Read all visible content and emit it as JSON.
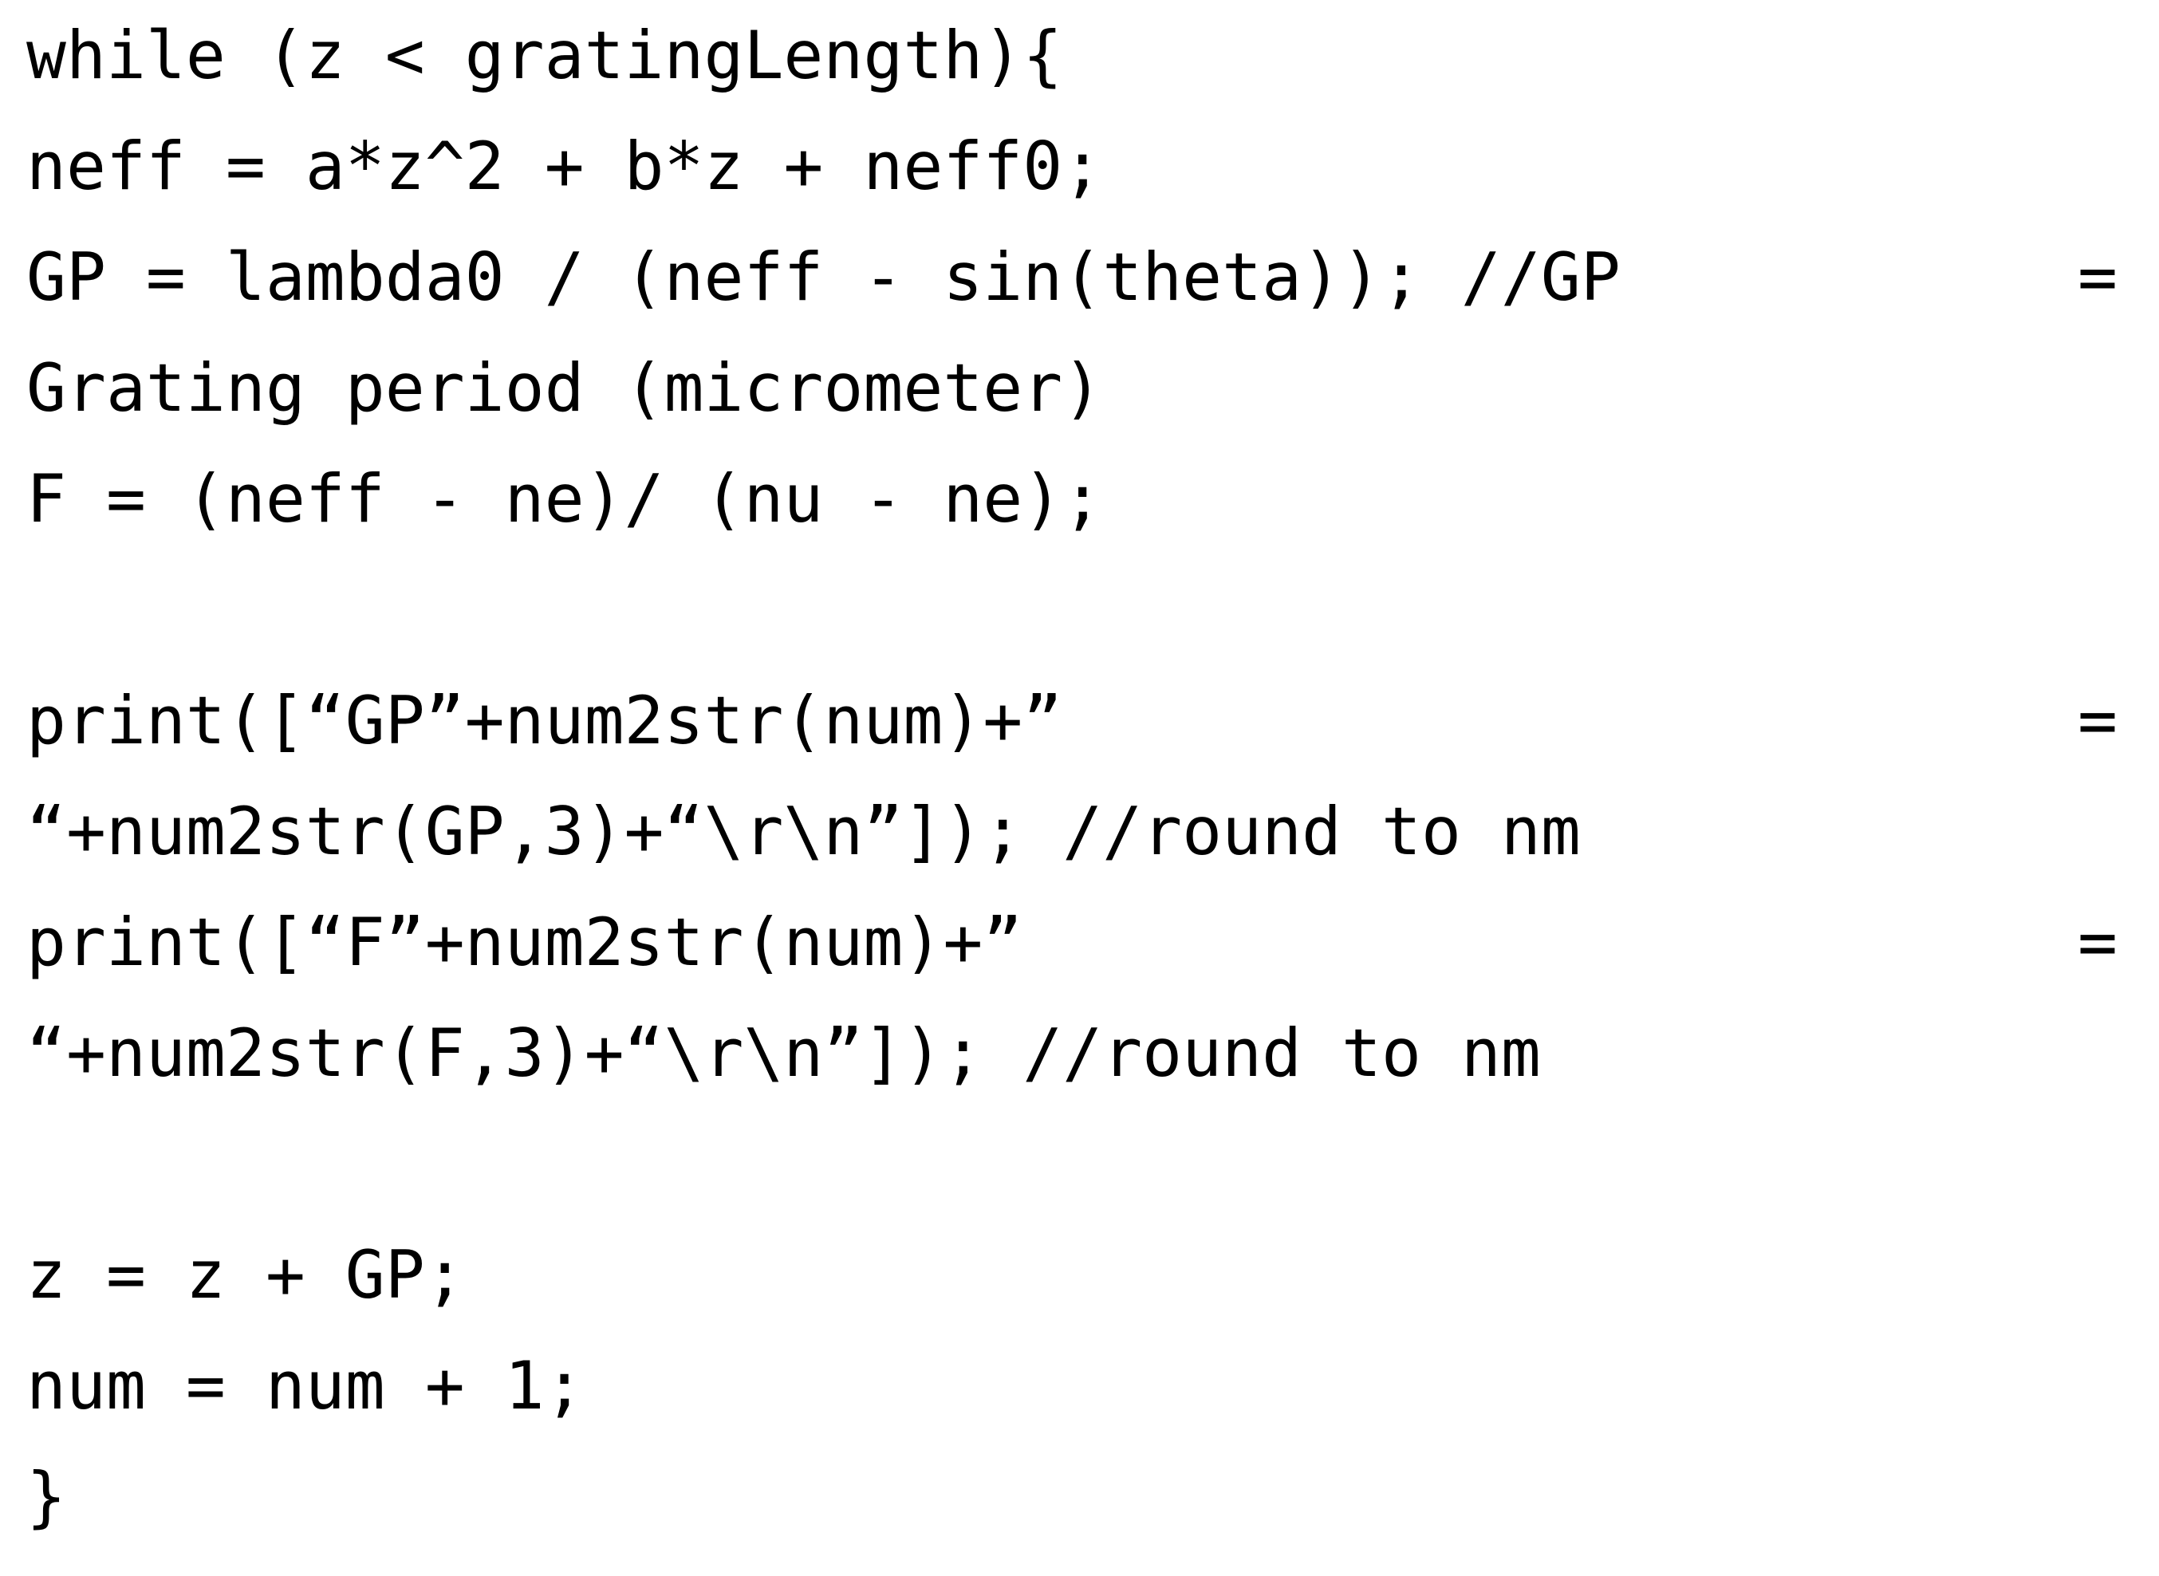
{
  "document": {
    "kind": "code-listing",
    "language": "pseudo-code",
    "background_color": "#ffffff",
    "text_color": "#000000"
  },
  "code": {
    "lines": [
      {
        "id": "line-while",
        "type": "code",
        "text": "while (z < gratingLength){"
      },
      {
        "id": "line-neff",
        "type": "code",
        "text": "neff = a*z^2 + b*z + neff0;"
      },
      {
        "id": "line-gp",
        "type": "justified",
        "left": "GP = lambda0 / (neff - sin(theta)); //GP",
        "right": "="
      },
      {
        "id": "line-gp-comment-cont",
        "type": "code",
        "text": "Grating period (micrometer)"
      },
      {
        "id": "line-f",
        "type": "code",
        "text": "F = (neff - ne)/ (nu - ne);"
      },
      {
        "id": "line-blank-1",
        "type": "blank",
        "text": ""
      },
      {
        "id": "line-print-gp",
        "type": "justified",
        "left": "print([“GP”+num2str(num)+”",
        "right": "="
      },
      {
        "id": "line-print-gp-cont",
        "type": "code",
        "text": "“+num2str(GP,3)+“\\r\\n”]); //round to nm"
      },
      {
        "id": "line-print-f",
        "type": "justified",
        "left": "print([“F”+num2str(num)+”",
        "right": "="
      },
      {
        "id": "line-print-f-cont",
        "type": "code",
        "text": "“+num2str(F,3)+“\\r\\n”]); //round to nm"
      },
      {
        "id": "line-blank-2",
        "type": "blank",
        "text": ""
      },
      {
        "id": "line-z-update",
        "type": "code",
        "text": "z = z + GP;"
      },
      {
        "id": "line-num-update",
        "type": "code",
        "text": "num = num + 1;"
      },
      {
        "id": "line-close-brace",
        "type": "code",
        "text": "}"
      }
    ]
  }
}
